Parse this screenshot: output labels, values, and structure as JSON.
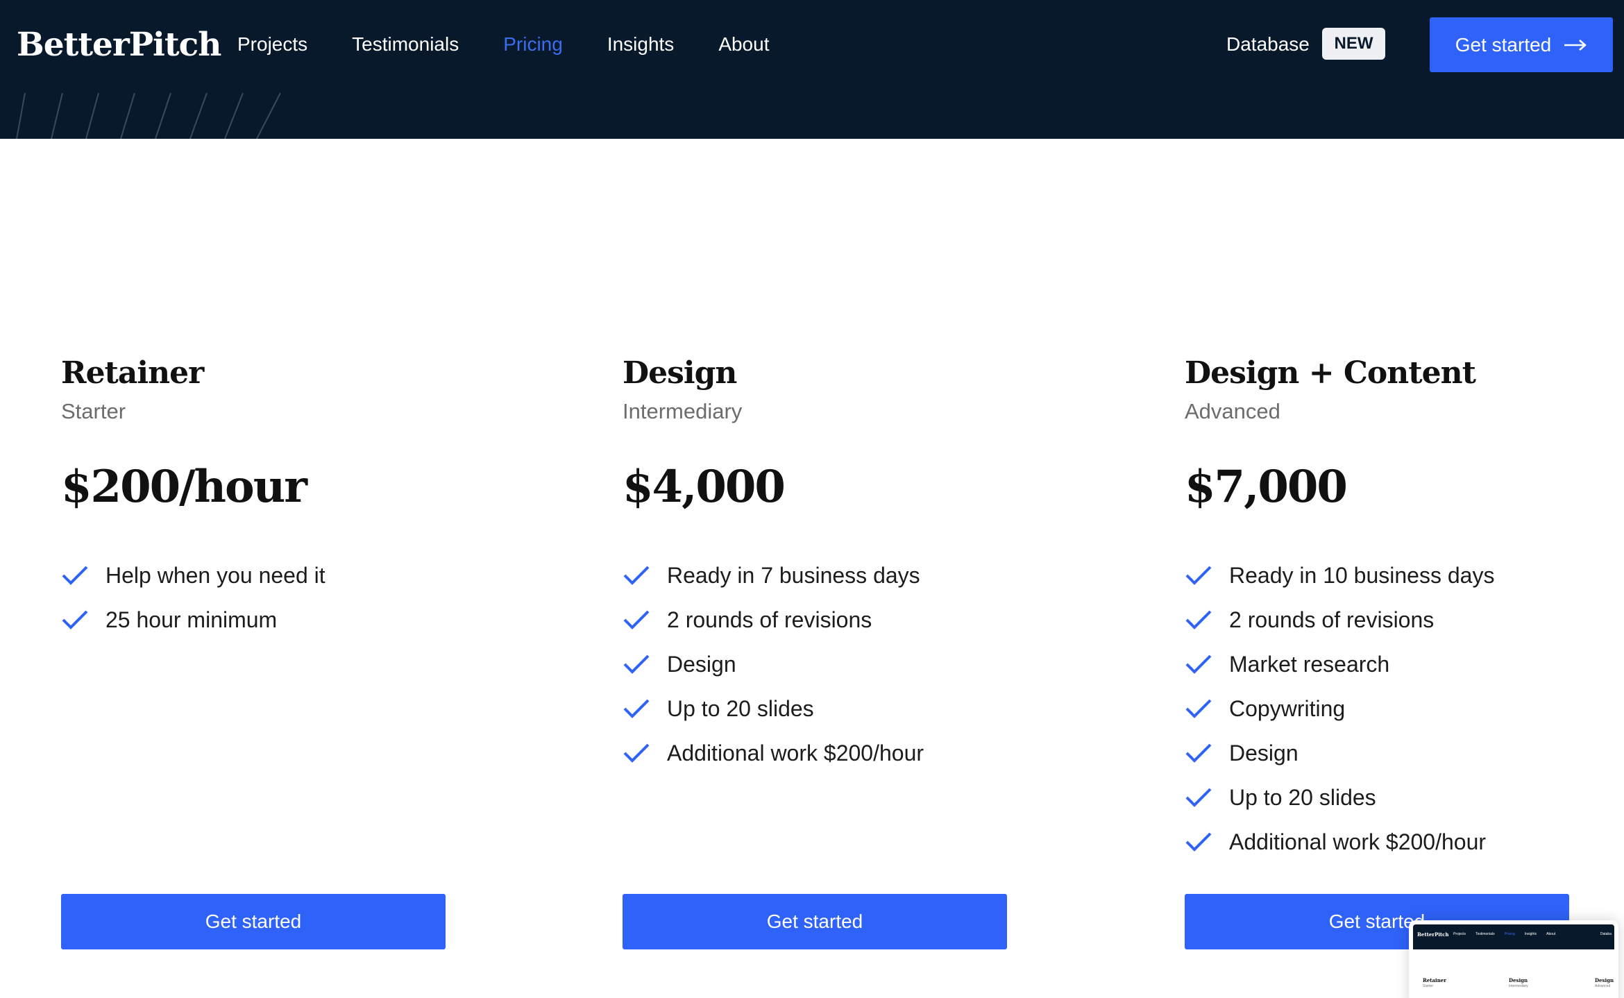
{
  "header": {
    "logo": "BetterPitch",
    "nav": [
      {
        "label": "Projects",
        "active": false
      },
      {
        "label": "Testimonials",
        "active": false
      },
      {
        "label": "Pricing",
        "active": true
      },
      {
        "label": "Insights",
        "active": false
      },
      {
        "label": "About",
        "active": false
      }
    ],
    "database_link": "Database",
    "badge": "NEW",
    "cta_label": "Get started",
    "cta_icon": "arrow-right-icon"
  },
  "colors": {
    "header_bg": "#08192b",
    "accent": "#2f62f8",
    "active_nav": "#3a6df0",
    "check": "#2f62f8"
  },
  "plans": [
    {
      "name": "Retainer",
      "tier": "Starter",
      "price": "$200/hour",
      "features": [
        "Help when you need it",
        "25 hour minimum"
      ],
      "button": "Get started"
    },
    {
      "name": "Design",
      "tier": "Intermediary",
      "price": "$4,000",
      "features": [
        "Ready in 7 business days",
        "2 rounds of revisions",
        "Design",
        "Up to 20 slides",
        "Additional work $200/hour"
      ],
      "button": "Get started"
    },
    {
      "name": "Design + Content",
      "tier": "Advanced",
      "price": "$7,000",
      "features": [
        "Ready in 10 business days",
        "2 rounds of revisions",
        "Market research",
        "Copywriting",
        "Design",
        "Up to 20 slides",
        "Additional work $200/hour"
      ],
      "button": "Get started"
    }
  ],
  "feature_icon": "check-icon",
  "preview": {
    "logo": "BetterPitch",
    "nav": [
      "Projects",
      "Testimonials",
      "Pricing",
      "Insights",
      "About"
    ],
    "db": "Databa",
    "plans": [
      {
        "name": "Retainer",
        "tier": "Starter"
      },
      {
        "name": "Design",
        "tier": "Intermediary"
      },
      {
        "name": "Design",
        "tier": "Advanced"
      }
    ]
  }
}
